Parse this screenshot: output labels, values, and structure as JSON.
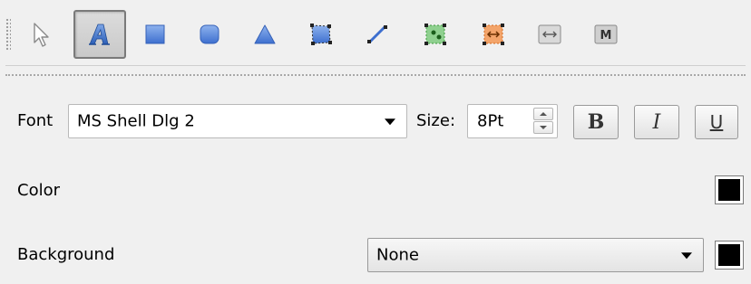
{
  "toolbar": {
    "tools": [
      {
        "name": "pointer-tool",
        "icon": "pointer-arrow-icon",
        "active": false
      },
      {
        "name": "text-tool",
        "icon": "text-a-icon",
        "active": true
      },
      {
        "name": "rectangle-tool",
        "icon": "rectangle-icon",
        "active": false
      },
      {
        "name": "rounded-rect-tool",
        "icon": "rounded-rectangle-icon",
        "active": false
      },
      {
        "name": "triangle-tool",
        "icon": "triangle-icon",
        "active": false
      },
      {
        "name": "polygon-tool",
        "icon": "polygon-icon",
        "active": false
      },
      {
        "name": "line-tool",
        "icon": "line-icon",
        "active": false
      },
      {
        "name": "green-shape-tool",
        "icon": "green-node-shape-icon",
        "active": false
      },
      {
        "name": "orange-shape-tool",
        "icon": "orange-node-shape-icon",
        "active": false
      },
      {
        "name": "dimension-tool",
        "icon": "double-arrow-icon",
        "active": false
      },
      {
        "name": "marker-tool",
        "icon": "m-box-icon",
        "active": false,
        "label": "M"
      }
    ]
  },
  "font_row": {
    "label": "Font",
    "font_value": "MS Shell Dlg 2",
    "size_label": "Size:",
    "size_value": "8Pt",
    "bold_label": "B",
    "italic_label": "I",
    "underline_label": "U"
  },
  "color_row": {
    "label": "Color",
    "color": "#000000"
  },
  "background_row": {
    "label": "Background",
    "value": "None",
    "color": "#000000"
  }
}
